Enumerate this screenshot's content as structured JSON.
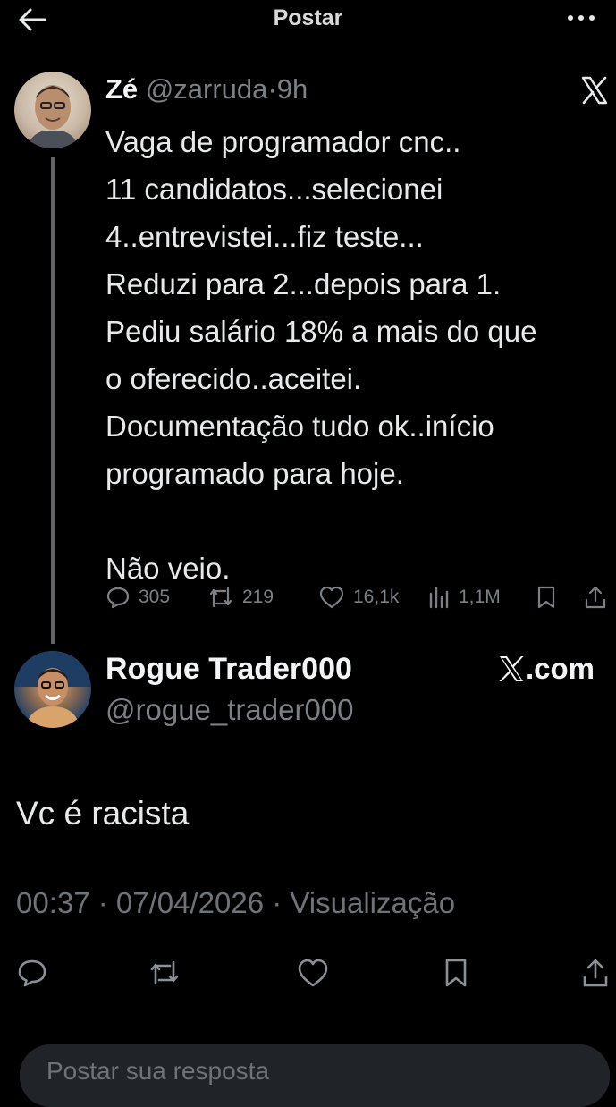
{
  "header": {
    "title": "Postar",
    "back_icon": "arrow-left-icon",
    "more_icon": "more-horizontal-icon"
  },
  "tweet": {
    "name": "Zé",
    "handle": "@zarruda",
    "separator": "·",
    "time": "9h",
    "lines": [
      "Vaga de programador cnc..",
      "11 candidatos...selecionei",
      "4..entrevistei...fiz teste...",
      "Reduzi para 2...depois para 1.",
      "Pediu salário 18% a mais do que",
      "o oferecido..aceitei.",
      "Documentação tudo ok..início",
      "programado para hoje."
    ],
    "closing": "Não veio.",
    "stats": {
      "replies": "305",
      "reposts": "219",
      "likes": "16,1k",
      "views": "1,1M"
    }
  },
  "reply": {
    "name": "Rogue Trader000",
    "handle": "@rogue_trader000",
    "site": ".com",
    "text": "Vc é racista",
    "timestamp": "00:37 · 07/04/2026 · Visualização"
  },
  "composer": {
    "placeholder": "Postar sua resposta"
  },
  "colors": {
    "background": "#000000",
    "text": "#e7e9ea",
    "muted": "#7b8085",
    "thread_line": "#5f6469"
  }
}
